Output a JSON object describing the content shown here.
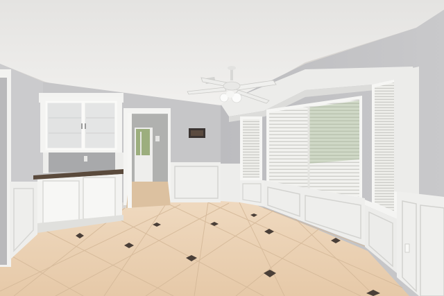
{
  "scene": {
    "subject": "empty-dining-room-with-bay-window",
    "colors": {
      "ceiling": "#e9e8e6",
      "wall": "#c4c4c6",
      "wall_shadow": "#b2b3b6",
      "trim": "#f4f4f2",
      "floor": "#ecd2b4",
      "floor_dark": "#d9bb9a",
      "tile_inset": "#4a3f38",
      "countertop": "#5a4a3c",
      "blinds": "#f1f1ee",
      "outside_green": "#7d9a6a"
    },
    "icons": [
      "ceiling-fan-icon",
      "light-fixture-icon"
    ]
  }
}
